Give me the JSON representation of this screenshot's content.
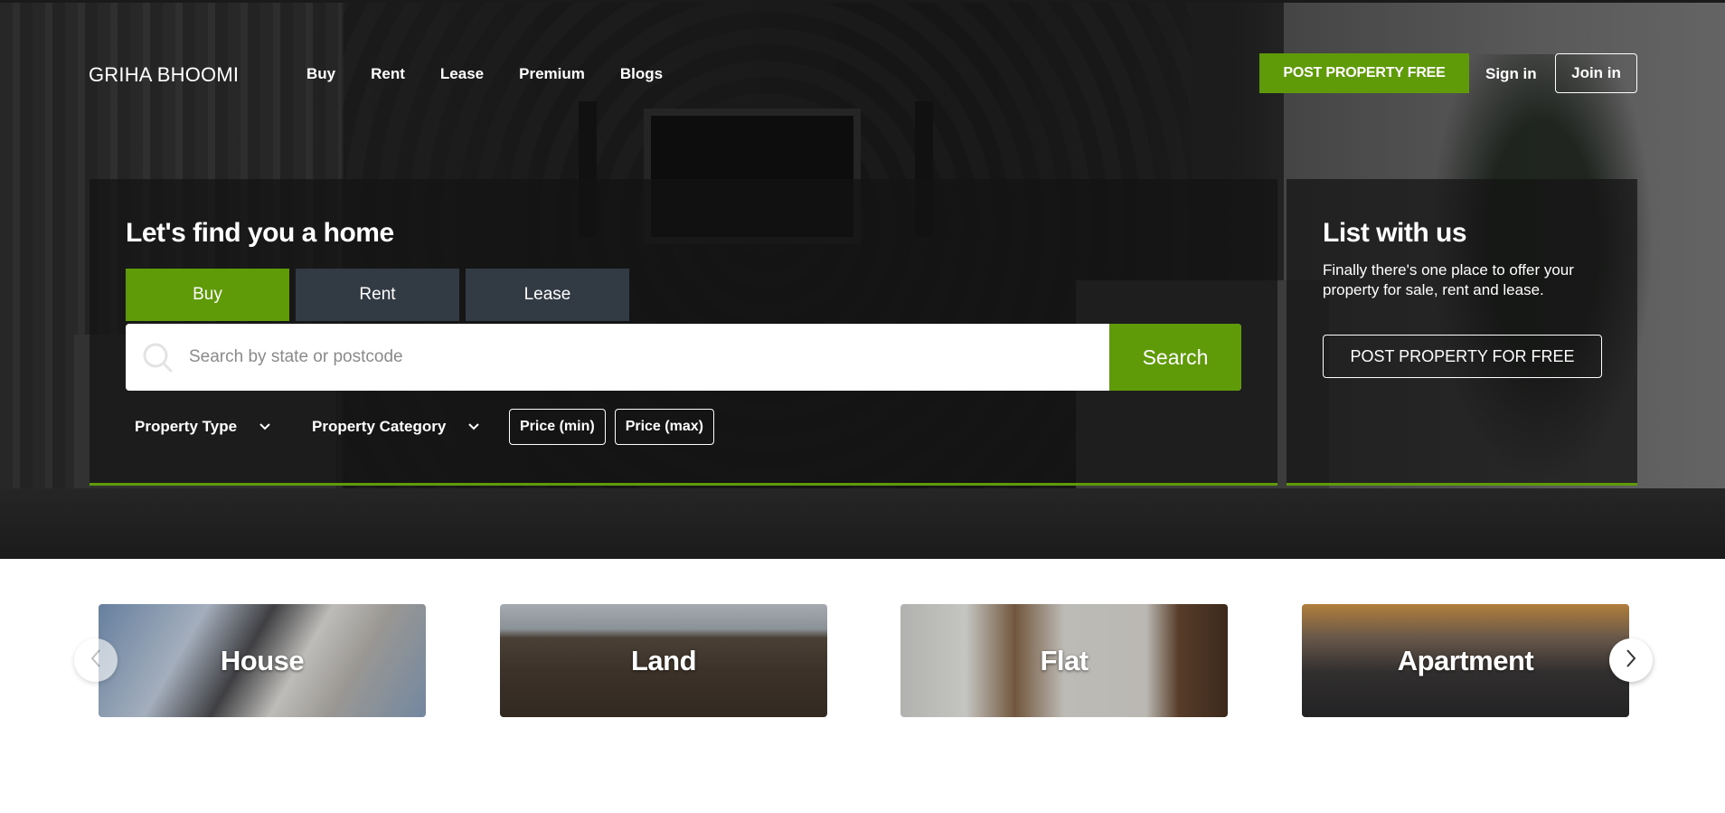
{
  "header": {
    "logo": "GRIHA BHOOMI",
    "nav": [
      "Buy",
      "Rent",
      "Lease",
      "Premium",
      "Blogs"
    ],
    "post_property": "POST PROPERTY FREE",
    "sign_in": "Sign in",
    "join_in": "Join in"
  },
  "search": {
    "title": "Let's find you a home",
    "tabs": [
      "Buy",
      "Rent",
      "Lease"
    ],
    "active_tab": "Buy",
    "placeholder": "Search by state or postcode",
    "button": "Search",
    "filters": {
      "property_type": "Property Type",
      "property_category": "Property Category",
      "price_min": "Price (min)",
      "price_max": "Price (max)"
    }
  },
  "list": {
    "title": "List with us",
    "text": "Finally there's one place to offer your property for sale, rent and lease.",
    "button": "POST PROPERTY FOR FREE"
  },
  "categories": [
    "House",
    "Land",
    "Flat",
    "Apartment"
  ],
  "colors": {
    "accent": "#5f9a09",
    "tab_inactive": "#323a44"
  },
  "icons": {
    "search": "search-icon",
    "dropdown": "chevron-down-icon",
    "prev": "chevron-left-icon",
    "next": "chevron-right-icon"
  }
}
